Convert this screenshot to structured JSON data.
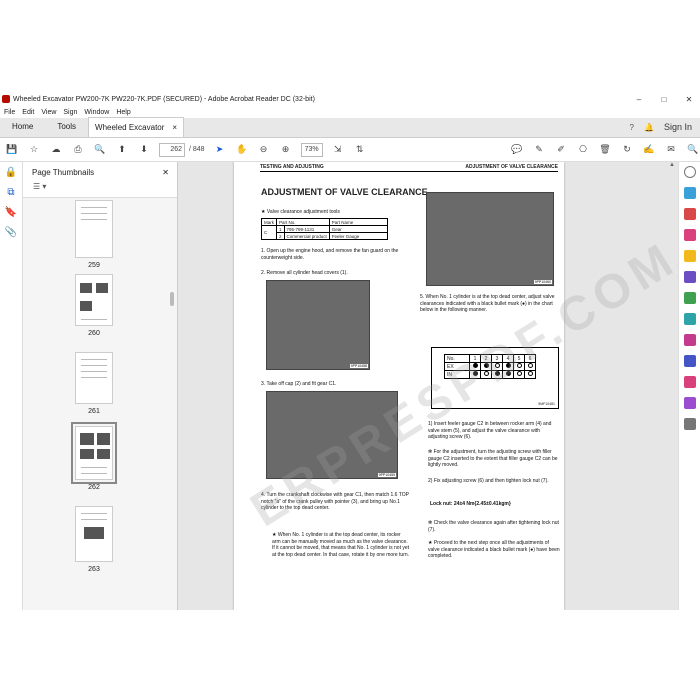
{
  "window": {
    "title": "Wheeled Excavator PW200-7K PW220-7K.PDF (SECURED) - Adobe Acrobat Reader DC (32-bit)",
    "minimize": "–",
    "maximize": "□",
    "close": "✕"
  },
  "menu": [
    "File",
    "Edit",
    "View",
    "Sign",
    "Window",
    "Help"
  ],
  "tabs": {
    "home": "Home",
    "tools": "Tools",
    "document": "Wheeled Excavator ...",
    "close": "×",
    "sign_in": "Sign In"
  },
  "toolbar": {
    "current_page": "262",
    "total_pages": "/ 848",
    "zoom": "73%"
  },
  "panel": {
    "title": "Page Thumbnails",
    "close": "✕",
    "options": "☰ ▾",
    "thumbs": [
      {
        "label": "259"
      },
      {
        "label": "260"
      },
      {
        "label": "261"
      },
      {
        "label": "262",
        "active": true
      },
      {
        "label": "263"
      }
    ]
  },
  "doc": {
    "running_head_left": "TESTING AND ADJUSTING",
    "running_head_right": "ADJUSTMENT OF VALVE CLEARANCE",
    "title": "ADJUSTMENT OF VALVE CLEARANCE",
    "tools_heading": "★   Valve clearance adjustment tools",
    "tools_table": {
      "head": [
        "Mark",
        "Part No.",
        "Part Name"
      ],
      "group": "C",
      "rows": [
        [
          "1",
          "795-799-1131",
          "Gear"
        ],
        [
          "2",
          "Commercial product",
          "Feeler Gauge"
        ]
      ]
    },
    "step1": "1.   Open up the engine hood, and remove the fan guard on the counterweight side.",
    "step2": "2.   Remove all cylinder head covers (1).",
    "photo1_cap": "9PP10458",
    "step3": "3.   Take off cap (2) and fit gear C1.",
    "photo2_cap": "9PP10459",
    "step4": "4.   Turn the crankshaft clockwise with gear C1, then match 1.6 TOP notch \"a\" of the crank pulley with pointer (3), and bring up No.1 cylinder to the top dead center.",
    "step4_note": "★   When No. 1 cylinder is at the top dead center, its rocker arm can be manually moved as much as the valve clearance. If it cannot be moved, that means that No. 1 cylinder is not yet at the top dead center. In that case, rotate it by one more turn.",
    "photo3_cap": "9PP10460",
    "step5": "5.   When No. 1 cylinder is at the top dead center, adjust valve clearances indicated with a black bullet mark (●) in the chart below in the following manner.",
    "chart": {
      "head": "No.",
      "cols": [
        "1",
        "2",
        "3",
        "4",
        "5",
        "6"
      ],
      "ex_label": "EX",
      "in_label": "IN",
      "ex": [
        1,
        1,
        0,
        1,
        0,
        0
      ],
      "in": [
        1,
        0,
        1,
        1,
        0,
        0
      ],
      "caption": "9MF10481"
    },
    "sub1": "1)   Insert feeler gauge C2 in between rocker arm (4) and valve stem (5), and adjust the valve clearance with adjusting screw (6).",
    "sub1_note": "✻   For the adjustment, turn the adjusting screw with filler gauge C2 inserted to the extent that filler gauge C2 can be lightly moved.",
    "sub2": "2)   Fix adjusting screw (6) and then tighten lock nut (7).",
    "locknut": "Lock nut: 24±4 Nm{2.45±0.41kgm}",
    "check_note": "✻   Check the valve clearance again after tightening lock nut (7).",
    "proceed_note": "★   Proceed to the next step once all the adjustments of valve clearance indicated a black bullet mark (●) have been completed.",
    "watermark": "ERPRESPDF.COM"
  }
}
